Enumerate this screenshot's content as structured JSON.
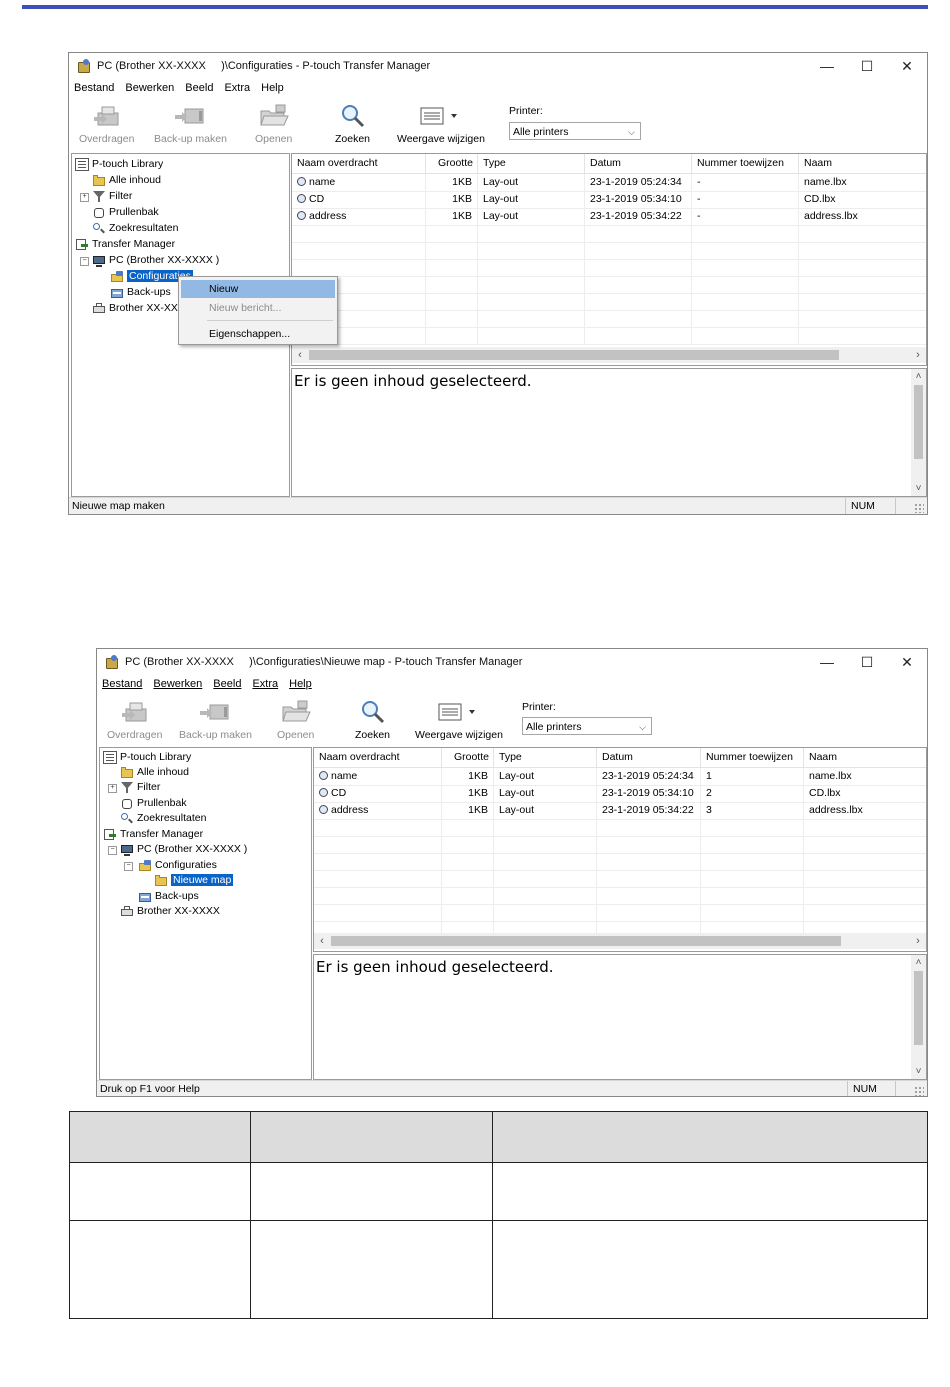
{
  "screen1": {
    "title": "PC (Brother XX-XXXX )\\Configuraties - P-touch Transfer Manager",
    "title_parts": [
      "PC (Brother",
      "XX-XXXX",
      ")\\Configuraties - P-touch Transfer Manager"
    ],
    "window_controls": {
      "minimize": "—",
      "maximize": "☐",
      "close": "✕"
    },
    "menu": [
      "Bestand",
      "Bewerken",
      "Beeld",
      "Extra",
      "Help"
    ],
    "toolbar": {
      "transfer": "Overdragen",
      "backup": "Back-up maken",
      "open": "Openen",
      "search": "Zoeken",
      "view": "Weergave wijzigen",
      "printer_label": "Printer:",
      "printer_value": "Alle printers"
    },
    "tree": {
      "library": "P-touch Library",
      "all": "Alle inhoud",
      "filter": "Filter",
      "bin": "Prullenbak",
      "results": "Zoekresultaten",
      "transfer_manager": "Transfer Manager",
      "pc": "PC (Brother XX-XXXX )",
      "configs": "Configuraties",
      "backups": "Back-ups",
      "brother": "Brother XX-XX"
    },
    "columns": [
      "Naam overdracht",
      "Grootte",
      "Type",
      "Datum",
      "Nummer toewijzen",
      "Naam"
    ],
    "rows": [
      {
        "name": "name",
        "size": "1KB",
        "type": "Lay-out",
        "date": "23-1-2019 05:24:34",
        "num": "-",
        "file": "name.lbx"
      },
      {
        "name": "CD",
        "size": "1KB",
        "type": "Lay-out",
        "date": "23-1-2019 05:34:10",
        "num": "-",
        "file": "CD.lbx"
      },
      {
        "name": "address",
        "size": "1KB",
        "type": "Lay-out",
        "date": "23-1-2019 05:34:22",
        "num": "-",
        "file": "address.lbx"
      }
    ],
    "preview_text": "Er is geen inhoud geselecteerd.",
    "context_menu": {
      "new": "Nieuw",
      "new_message": "Nieuw bericht...",
      "properties": "Eigenschappen..."
    },
    "status": "Nieuwe map maken",
    "status_num": "NUM"
  },
  "screen2": {
    "title": "PC (Brother XX-XXXX )\\Configuraties\\Nieuwe map - P-touch Transfer Manager",
    "title_parts": [
      "PC (Brother",
      "XX-XXXX",
      ")\\Configuraties\\Nieuwe map - P-touch Transfer Manager"
    ],
    "window_controls": {
      "minimize": "—",
      "maximize": "☐",
      "close": "✕"
    },
    "menu": [
      "Bestand",
      "Bewerken",
      "Beeld",
      "Extra",
      "Help"
    ],
    "toolbar": {
      "transfer": "Overdragen",
      "backup": "Back-up maken",
      "open": "Openen",
      "search": "Zoeken",
      "view": "Weergave wijzigen",
      "printer_label": "Printer:",
      "printer_value": "Alle printers"
    },
    "tree": {
      "library": "P-touch Library",
      "all": "Alle inhoud",
      "filter": "Filter",
      "bin": "Prullenbak",
      "results": "Zoekresultaten",
      "transfer_manager": "Transfer Manager",
      "pc": "PC (Brother XX-XXXX )",
      "configs": "Configuraties",
      "new_folder": "Nieuwe map",
      "backups": "Back-ups",
      "brother": "Brother XX-XXXX"
    },
    "columns": [
      "Naam overdracht",
      "Grootte",
      "Type",
      "Datum",
      "Nummer toewijzen",
      "Naam"
    ],
    "rows": [
      {
        "name": "name",
        "size": "1KB",
        "type": "Lay-out",
        "date": "23-1-2019 05:24:34",
        "num": "1",
        "file": "name.lbx"
      },
      {
        "name": "CD",
        "size": "1KB",
        "type": "Lay-out",
        "date": "23-1-2019 05:34:10",
        "num": "2",
        "file": "CD.lbx"
      },
      {
        "name": "address",
        "size": "1KB",
        "type": "Lay-out",
        "date": "23-1-2019 05:34:22",
        "num": "3",
        "file": "address.lbx"
      }
    ],
    "preview_text": "Er is geen inhoud geselecteerd.",
    "status": "Druk op F1 voor Help",
    "status_num": "NUM"
  },
  "accent_color": "#3d4fb8",
  "selection_color": "#0a64c8"
}
